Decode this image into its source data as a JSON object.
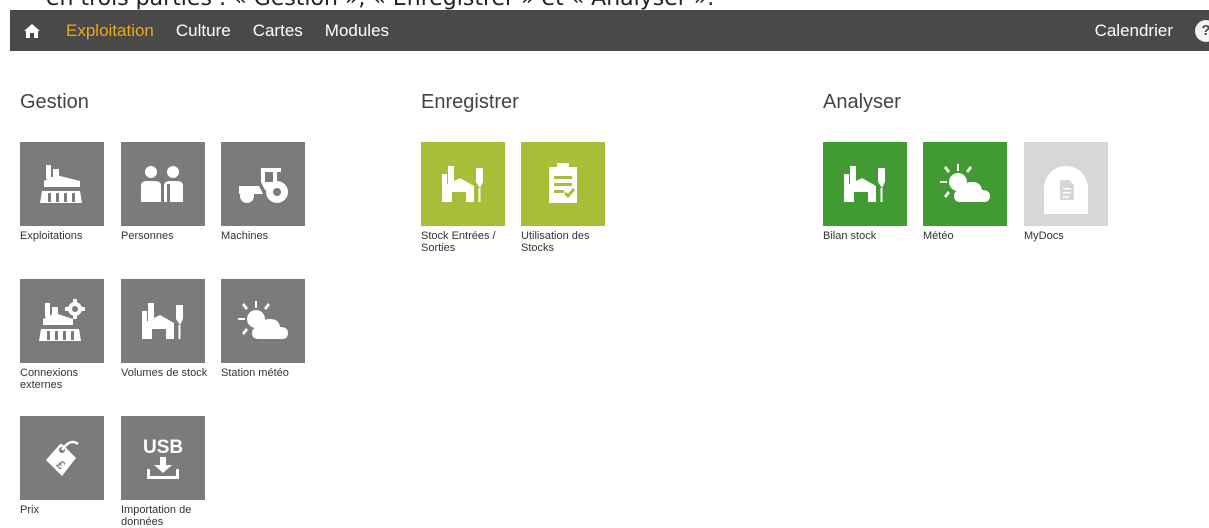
{
  "caption": "en trois parties : « Gestion », « Enregistrer » et « Analyser ».",
  "nav": {
    "items": [
      "Exploitation",
      "Culture",
      "Cartes",
      "Modules"
    ],
    "active": "Exploitation",
    "calendar": "Calendrier",
    "help": "?"
  },
  "colors": {
    "topbar": "#494949",
    "active_nav": "#f0a818",
    "tile_gray": "#7b7b7b",
    "tile_lime": "#a8bd38",
    "tile_green": "#419a32",
    "tile_light": "#d7d7d7"
  },
  "sections": {
    "gestion": {
      "title": "Gestion",
      "tiles": [
        {
          "label": "Exploitations",
          "icon": "farm-buildings-icon"
        },
        {
          "label": "Personnes",
          "icon": "people-icon"
        },
        {
          "label": "Machines",
          "icon": "tractor-icon"
        },
        {
          "label": "Connexions externes",
          "icon": "farm-gear-icon"
        },
        {
          "label": "Volumes de stock",
          "icon": "silo-icon"
        },
        {
          "label": "Station météo",
          "icon": "sun-cloud-icon"
        },
        {
          "label": "Prix",
          "icon": "price-tag-icon"
        },
        {
          "label": "Importation de données",
          "icon": "usb-import-icon"
        }
      ]
    },
    "enregistrer": {
      "title": "Enregistrer",
      "tiles": [
        {
          "label": "Stock Entrées / Sorties",
          "icon": "silo-in-out-icon"
        },
        {
          "label": "Utilisation des Stocks",
          "icon": "clipboard-check-icon"
        }
      ]
    },
    "analyser": {
      "title": "Analyser",
      "tiles": [
        {
          "label": "Bilan stock",
          "icon": "silo-icon"
        },
        {
          "label": "Météo",
          "icon": "sun-cloud-icon"
        },
        {
          "label": "MyDocs",
          "icon": "document-icon"
        }
      ]
    }
  }
}
